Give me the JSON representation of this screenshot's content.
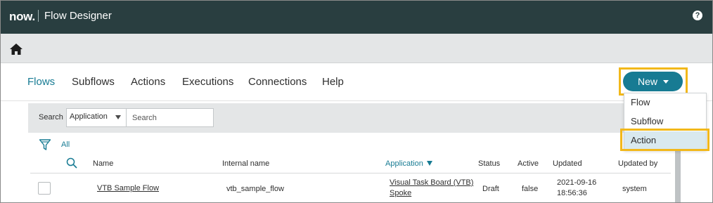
{
  "header": {
    "logo_text": "now.",
    "app_title": "Flow Designer",
    "help_icon": "question-circle-icon",
    "background_color": "#293e40"
  },
  "homebar": {
    "home_icon": "home-icon"
  },
  "nav": {
    "tabs": [
      {
        "label": "Flows",
        "active": true
      },
      {
        "label": "Subflows",
        "active": false
      },
      {
        "label": "Actions",
        "active": false
      },
      {
        "label": "Executions",
        "active": false
      },
      {
        "label": "Connections",
        "active": false
      },
      {
        "label": "Help",
        "active": false
      }
    ],
    "new_button_label": "New",
    "accent_color": "#177b93",
    "highlight_color": "#f2b81a"
  },
  "new_menu": {
    "items": [
      {
        "label": "Flow",
        "selected": false
      },
      {
        "label": "Subflow",
        "selected": false
      },
      {
        "label": "Action",
        "selected": true
      }
    ]
  },
  "search": {
    "label": "Search",
    "field_selected": "Application",
    "placeholder": "Search"
  },
  "filter": {
    "icon": "funnel-filter-icon",
    "label": "All"
  },
  "table": {
    "columns": [
      "Name",
      "Internal name",
      "Application",
      "Status",
      "Active",
      "Updated",
      "Updated by"
    ],
    "sorted_column": "Application",
    "rows": [
      {
        "name": "VTB Sample Flow",
        "internal_name": "vtb_sample_flow",
        "application_line1": "Visual Task Board (VTB)",
        "application_line2": "Spoke",
        "status": "Draft",
        "active": "false",
        "updated_line1": "2021-09-16",
        "updated_line2": "18:56:36",
        "updated_by": "system"
      }
    ]
  }
}
